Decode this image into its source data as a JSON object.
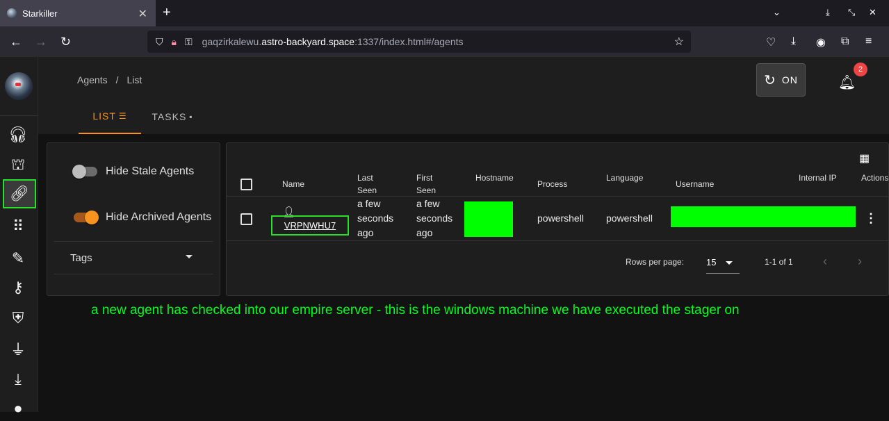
{
  "browser": {
    "tab_title": "Starkiller",
    "tab_close": "✕",
    "new_tab": "+",
    "url_prefix": "gaqzirkalewu.",
    "url_domain": "astro-backyard.space",
    "url_suffix": ":1337/index.html#/agents"
  },
  "header": {
    "breadcrumb_agents": "Agents",
    "breadcrumb_sep": "/",
    "breadcrumb_list": "List",
    "on_label": "ON",
    "notifications_count": "2",
    "tabs": [
      {
        "label": "LIST"
      },
      {
        "label": "TASKS"
      }
    ]
  },
  "filters": {
    "hide_stale_label": "Hide Stale Agents",
    "hide_stale_on": false,
    "hide_archived_label": "Hide Archived Agents",
    "hide_archived_on": true,
    "tags_label": "Tags"
  },
  "table": {
    "columns": {
      "name": "Name",
      "last_seen_1": "Last",
      "last_seen_2": "Seen",
      "first_seen_1": "First",
      "first_seen_2": "Seen",
      "hostname": "Hostname",
      "process": "Process",
      "language": "Language",
      "username": "Username",
      "internal_ip": "Internal IP",
      "actions": "Actions"
    },
    "rows": [
      {
        "name": "VRPNWHU7",
        "last_seen": [
          "a few",
          "seconds",
          "ago"
        ],
        "first_seen": [
          "a few",
          "seconds",
          "ago"
        ],
        "process": "powershell",
        "language": "powershell"
      }
    ],
    "rows_per_page_label": "Rows per page:",
    "rows_per_page": "15",
    "range": "1-1 of 1"
  },
  "annotation": "a new agent has checked into our empire server - this is the windows machine we have executed the stager on",
  "colors": {
    "accent": "#f7931e",
    "highlight": "#27e027",
    "redaction": "#00ff00"
  }
}
